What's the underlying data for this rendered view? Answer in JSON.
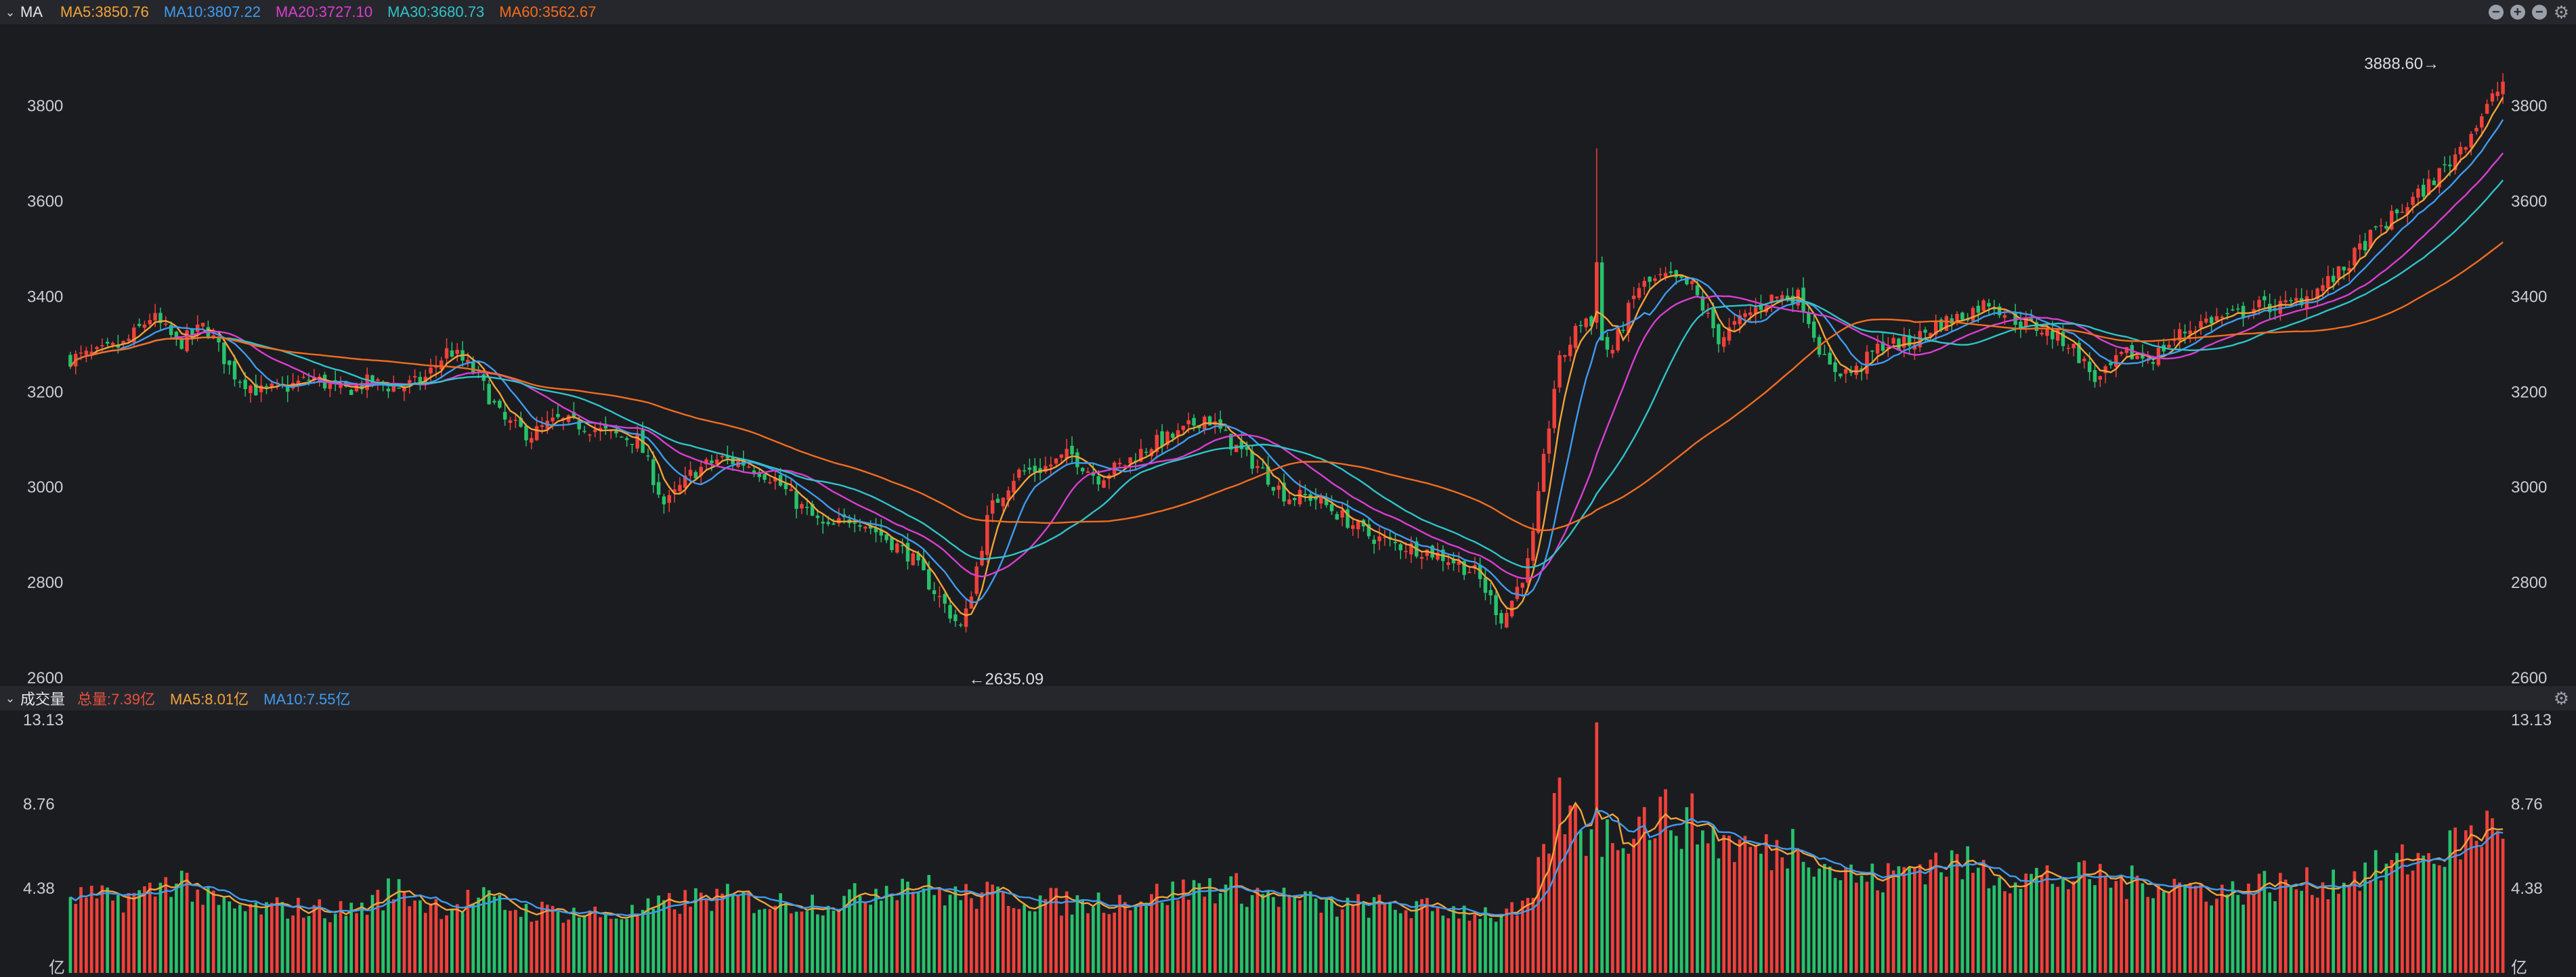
{
  "price_header": {
    "name": "MA",
    "items": [
      {
        "label": "MA5:3850.76",
        "color": "#f2a33a"
      },
      {
        "label": "MA10:3807.22",
        "color": "#3f9cf0"
      },
      {
        "label": "MA20:3727.10",
        "color": "#d93fd0"
      },
      {
        "label": "MA30:3680.73",
        "color": "#2fc4c9"
      },
      {
        "label": "MA60:3562.67",
        "color": "#f26d21"
      }
    ]
  },
  "volume_header": {
    "name": "成交量",
    "items": [
      {
        "label": "总量:7.39亿",
        "color": "#e8503f"
      },
      {
        "label": "MA5:8.01亿",
        "color": "#f2a33a"
      },
      {
        "label": "MA10:7.55亿",
        "color": "#3f9cf0"
      }
    ]
  },
  "icons": [
    "zoom-out-icon",
    "zoom-in-icon",
    "minimize-icon",
    "gear-icon"
  ],
  "colors": {
    "up": "#f0413a",
    "down": "#27c26b",
    "grid_text": "#c9ccd3",
    "bg": "#1b1c20"
  },
  "chart_data": [
    {
      "type": "candlestick",
      "title": "MA",
      "y_ticks": [
        "3800",
        "3600",
        "3400",
        "3200",
        "3000",
        "2800",
        "2600"
      ],
      "ylim": [
        2600,
        3920
      ],
      "annotations": {
        "high": "3888.60",
        "low": "2635.09"
      },
      "close_path": [
        3270,
        3280,
        3300,
        3360,
        3300,
        3340,
        3240,
        3200,
        3210,
        3230,
        3200,
        3220,
        3210,
        3220,
        3290,
        3240,
        3140,
        3110,
        3140,
        3130,
        3110,
        3100,
        2960,
        3030,
        3060,
        3050,
        3020,
        2960,
        2910,
        2940,
        2900,
        2860,
        2780,
        2700,
        2950,
        3030,
        3040,
        3070,
        3020,
        3050,
        3090,
        3110,
        3150,
        3090,
        3040,
        2980,
        2980,
        2940,
        2900,
        2880,
        2870,
        2850,
        2820,
        2720,
        2850,
        3250,
        3360,
        3280,
        3420,
        3440,
        3420,
        3310,
        3360,
        3400,
        3400,
        3250,
        3240,
        3300,
        3300,
        3340,
        3360,
        3390,
        3350,
        3330,
        3300,
        3220,
        3280,
        3270,
        3320,
        3350,
        3360,
        3380,
        3380,
        3410,
        3450,
        3520,
        3570,
        3620,
        3680,
        3760,
        3850
      ]
    },
    {
      "type": "bar",
      "title": "成交量",
      "y_ticks": [
        "13.13",
        "8.76",
        "4.38"
      ],
      "unit": "亿",
      "ylim": [
        0,
        13.13
      ],
      "volume_path": [
        4.0,
        3.8,
        3.9,
        4.2,
        5.1,
        3.8,
        3.3,
        3.3,
        3.4,
        3.3,
        3.2,
        3.5,
        4.4,
        3.7,
        3.4,
        3.9,
        3.5,
        3.2,
        3.2,
        3.1,
        3.0,
        3.1,
        3.5,
        3.8,
        3.9,
        3.8,
        3.6,
        3.7,
        3.7,
        3.9,
        4.5,
        4.8,
        4.2,
        4.0,
        4.0,
        3.9,
        3.8,
        3.6,
        3.7,
        3.8,
        4.0,
        4.2,
        4.5,
        4.4,
        4.1,
        3.9,
        3.6,
        3.4,
        3.5,
        3.4,
        3.3,
        3.3,
        3.2,
        3.0,
        3.3,
        8.8,
        7.3,
        7.0,
        7.9,
        8.2,
        7.8,
        6.9,
        6.5,
        6.2,
        7.0,
        5.5,
        5.0,
        4.8,
        5.5,
        5.8,
        5.6,
        5.2,
        5.0,
        5.0,
        4.8,
        5.0,
        4.6,
        4.8,
        4.6,
        4.3,
        4.2,
        4.6,
        4.5,
        4.6,
        4.9,
        5.2,
        5.6,
        6.0,
        6.4,
        7.2,
        8.0
      ]
    }
  ]
}
